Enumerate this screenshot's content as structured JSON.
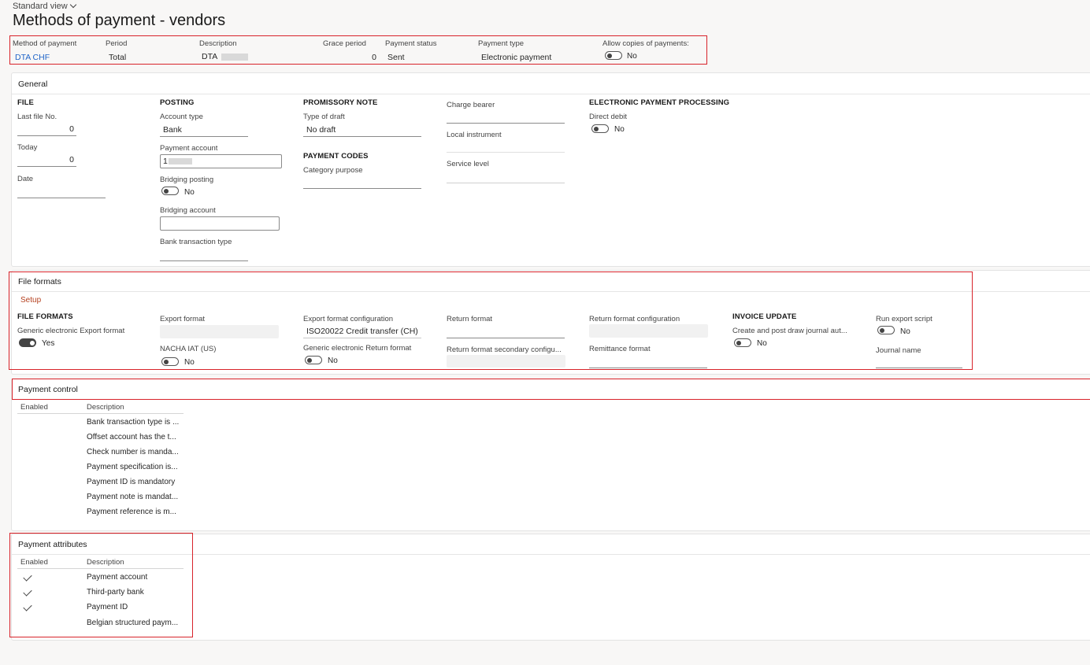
{
  "view": {
    "label": "Standard view"
  },
  "page": {
    "title": "Methods of payment - vendors"
  },
  "header": {
    "labels": {
      "method": "Method of payment",
      "period": "Period",
      "description": "Description",
      "grace": "Grace period",
      "status": "Payment status",
      "type": "Payment type",
      "copies": "Allow copies of payments:"
    },
    "values": {
      "method": "DTA CHF",
      "period": "Total",
      "description": "DTA",
      "grace": "0",
      "status": "Sent",
      "type": "Electronic payment",
      "copies": "No"
    }
  },
  "general": {
    "title": "General",
    "file": {
      "heading": "FILE",
      "last_file_label": "Last file No.",
      "last_file_value": "0",
      "today_label": "Today",
      "today_value": "0",
      "date_label": "Date"
    },
    "posting": {
      "heading": "POSTING",
      "account_type_label": "Account type",
      "account_type_value": "Bank",
      "payment_account_label": "Payment account",
      "payment_account_value": "1",
      "bridging_posting_label": "Bridging posting",
      "bridging_posting_value": "No",
      "bridging_account_label": "Bridging account",
      "bank_transaction_label": "Bank transaction type"
    },
    "promissory": {
      "heading": "PROMISSORY NOTE",
      "type_label": "Type of draft",
      "type_value": "No draft"
    },
    "codes": {
      "heading": "PAYMENT CODES",
      "category_label": "Category purpose"
    },
    "charge_bearer_label": "Charge bearer",
    "local_instrument_label": "Local instrument",
    "service_level_label": "Service level",
    "epp": {
      "heading": "ELECTRONIC PAYMENT PROCESSING",
      "direct_debit_label": "Direct debit",
      "direct_debit_value": "No"
    }
  },
  "file_formats": {
    "title": "File formats",
    "setup_label": "Setup",
    "heading": "FILE FORMATS",
    "generic_export_label": "Generic electronic Export format",
    "generic_export_value": "Yes",
    "export_format_label": "Export format",
    "nacha_label": "NACHA IAT (US)",
    "nacha_value": "No",
    "export_config_label": "Export format configuration",
    "export_config_value": "ISO20022 Credit transfer (CH)",
    "generic_return_label": "Generic electronic Return format",
    "generic_return_value": "No",
    "return_format_label": "Return format",
    "return_secondary_label": "Return format secondary configu...",
    "return_config_label": "Return format configuration",
    "remittance_label": "Remittance format",
    "invoice_heading": "INVOICE UPDATE",
    "create_post_label": "Create and post draw journal aut...",
    "create_post_value": "No",
    "run_script_label": "Run export script",
    "run_script_value": "No",
    "journal_name_label": "Journal name"
  },
  "payment_control": {
    "title": "Payment control",
    "col_enabled": "Enabled",
    "col_description": "Description",
    "rows": [
      "Bank transaction type is ...",
      "Offset account has the t...",
      "Check number is manda...",
      "Payment specification is...",
      "Payment ID is mandatory",
      "Payment note is mandat...",
      "Payment reference is m..."
    ]
  },
  "payment_attributes": {
    "title": "Payment attributes",
    "col_enabled": "Enabled",
    "col_description": "Description",
    "rows": [
      {
        "enabled": true,
        "description": "Payment account"
      },
      {
        "enabled": true,
        "description": "Third-party bank"
      },
      {
        "enabled": true,
        "description": "Payment ID"
      },
      {
        "enabled": false,
        "description": "Belgian structured paym..."
      }
    ]
  }
}
